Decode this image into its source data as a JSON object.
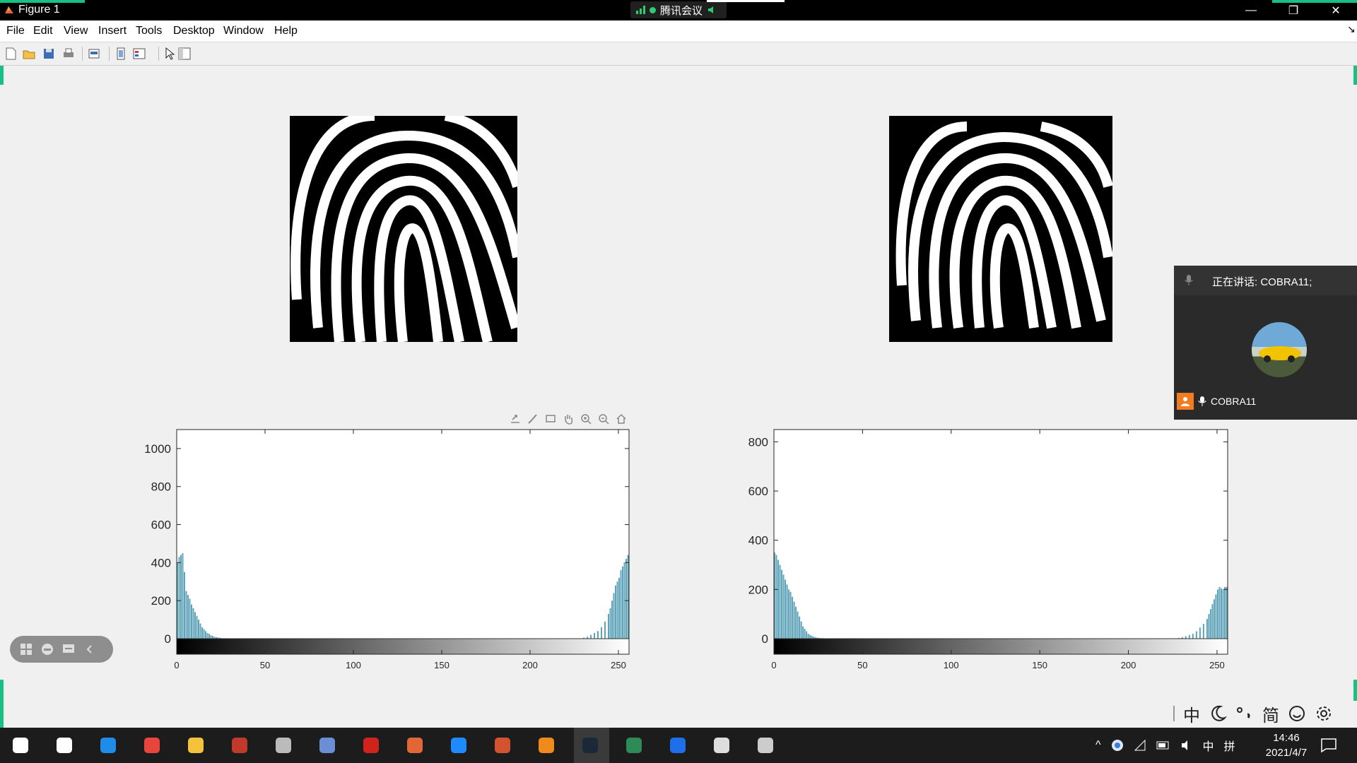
{
  "window": {
    "title": "Figure 1",
    "controls": {
      "minimize": "—",
      "restore": "❐",
      "close": "✕"
    }
  },
  "meeting_bar": {
    "label": "腾讯会议"
  },
  "menu": [
    "File",
    "Edit",
    "View",
    "Insert",
    "Tools",
    "Desktop",
    "Window",
    "Help"
  ],
  "toolbar_icons": [
    "new-figure-icon",
    "open-file-icon",
    "save-icon",
    "print-icon",
    "print-preview-icon",
    "link-plot-icon",
    "insert-legend-icon",
    "edit-plot-arrow-icon",
    "property-inspector-icon"
  ],
  "axes_toolbar_icons": [
    "export-icon",
    "brush-icon",
    "data-tips-icon",
    "pan-icon",
    "zoom-in-icon",
    "zoom-out-icon",
    "home-icon"
  ],
  "chart_data": [
    {
      "type": "bar",
      "title": "",
      "xlabel": "",
      "ylabel": "",
      "xlim": [
        0,
        255
      ],
      "ylim": [
        0,
        1100
      ],
      "xticks": [
        0,
        50,
        100,
        150,
        200,
        250
      ],
      "yticks": [
        0,
        200,
        400,
        600,
        800,
        1000
      ],
      "colorbar": "grayscale 0-255",
      "bar_color": "#5ea3b8",
      "x": [
        0,
        1,
        2,
        3,
        4,
        5,
        6,
        7,
        8,
        9,
        10,
        11,
        12,
        13,
        14,
        15,
        16,
        17,
        18,
        19,
        20,
        21,
        22,
        23,
        24,
        25,
        26,
        27,
        28,
        29,
        30,
        230,
        232,
        234,
        236,
        238,
        240,
        242,
        244,
        245,
        246,
        247,
        248,
        249,
        250,
        251,
        252,
        253,
        254,
        255
      ],
      "values": [
        400,
        430,
        440,
        450,
        350,
        250,
        230,
        210,
        180,
        160,
        140,
        120,
        100,
        80,
        60,
        50,
        40,
        30,
        25,
        18,
        14,
        10,
        8,
        6,
        4,
        3,
        2,
        2,
        1,
        1,
        0,
        5,
        10,
        20,
        30,
        40,
        60,
        90,
        130,
        160,
        200,
        240,
        280,
        300,
        320,
        360,
        380,
        400,
        420,
        440
      ]
    },
    {
      "type": "bar",
      "title": "",
      "xlabel": "",
      "ylabel": "",
      "xlim": [
        0,
        255
      ],
      "ylim": [
        0,
        850
      ],
      "xticks": [
        0,
        50,
        100,
        150,
        200,
        250
      ],
      "yticks": [
        0,
        200,
        400,
        600,
        800
      ],
      "colorbar": "grayscale 0-255",
      "bar_color": "#5ea3b8",
      "x": [
        0,
        1,
        2,
        3,
        4,
        5,
        6,
        7,
        8,
        9,
        10,
        11,
        12,
        13,
        14,
        15,
        16,
        17,
        18,
        19,
        20,
        21,
        22,
        23,
        24,
        25,
        26,
        27,
        28,
        29,
        30,
        228,
        230,
        232,
        234,
        236,
        238,
        240,
        242,
        244,
        245,
        246,
        247,
        248,
        249,
        250,
        251,
        252,
        253,
        254,
        255
      ],
      "values": [
        350,
        340,
        320,
        300,
        280,
        260,
        240,
        220,
        200,
        190,
        170,
        150,
        130,
        110,
        90,
        70,
        50,
        40,
        30,
        20,
        15,
        12,
        8,
        6,
        4,
        3,
        2,
        2,
        1,
        1,
        0,
        3,
        6,
        10,
        15,
        20,
        30,
        45,
        60,
        80,
        100,
        120,
        140,
        160,
        180,
        200,
        210,
        205,
        200,
        210,
        210
      ]
    }
  ],
  "meeting_panel": {
    "speaking_label": "正在讲话: COBRA11;",
    "user_name": "COBRA11"
  },
  "ime": {
    "mode": "中",
    "simplified": "简"
  },
  "taskbar": {
    "apps": [
      "start-icon",
      "task-view-icon",
      "edge-icon",
      "chrome-icon",
      "file-explorer-icon",
      "app-red-icon",
      "remote-desktop-icon",
      "document-app-icon",
      "acrobat-icon",
      "matlab-icon",
      "feishu-icon",
      "powerpoint-icon",
      "orange-app-icon",
      "steam-icon",
      "vim-icon",
      "tencent-meeting-icon",
      "photos-icon",
      "obs-icon"
    ],
    "tray_lang": "中",
    "tray_ime": "拼",
    "time": "14:46",
    "date": "2021/4/7"
  }
}
